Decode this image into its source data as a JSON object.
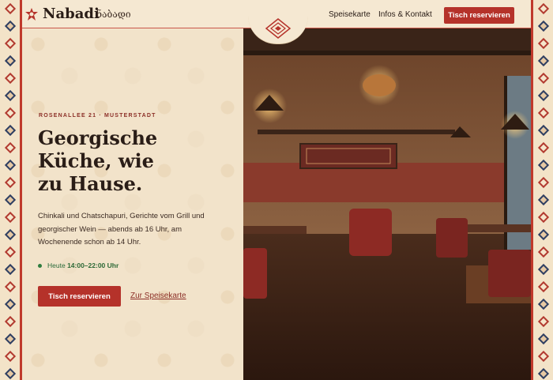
{
  "header": {
    "brand": "Nabadi",
    "brand_georgian": "ნაბადი",
    "nav": [
      "Speisekarte",
      "Infos & Kontakt"
    ],
    "cta": "Tisch reservieren",
    "logo_icon": "ornament-star-icon"
  },
  "hero": {
    "address": "ROSENALLEE 21 · MUSTERSTADT",
    "title_lines": [
      "Georgische",
      "Küche, wie",
      "zu Hause."
    ],
    "description": "Chinkali und Chatschapuri, Gerichte vom Grill und georgischer Wein — abends ab 16 Uhr, am Wochenende schon ab 14 Uhr.",
    "hours_label": "Heute",
    "hours_value": "14:00–22:00 Uhr",
    "primary_button": "Tisch reservieren",
    "secondary_link": "Zur Speisekarte"
  },
  "photo": {
    "subject": "restaurant-interior-image"
  },
  "colors": {
    "accent": "#b5322a",
    "background": "#f5e8d2",
    "text": "#2a1d17",
    "status_green": "#2f7d3f",
    "border_navy": "#2e3f63"
  }
}
